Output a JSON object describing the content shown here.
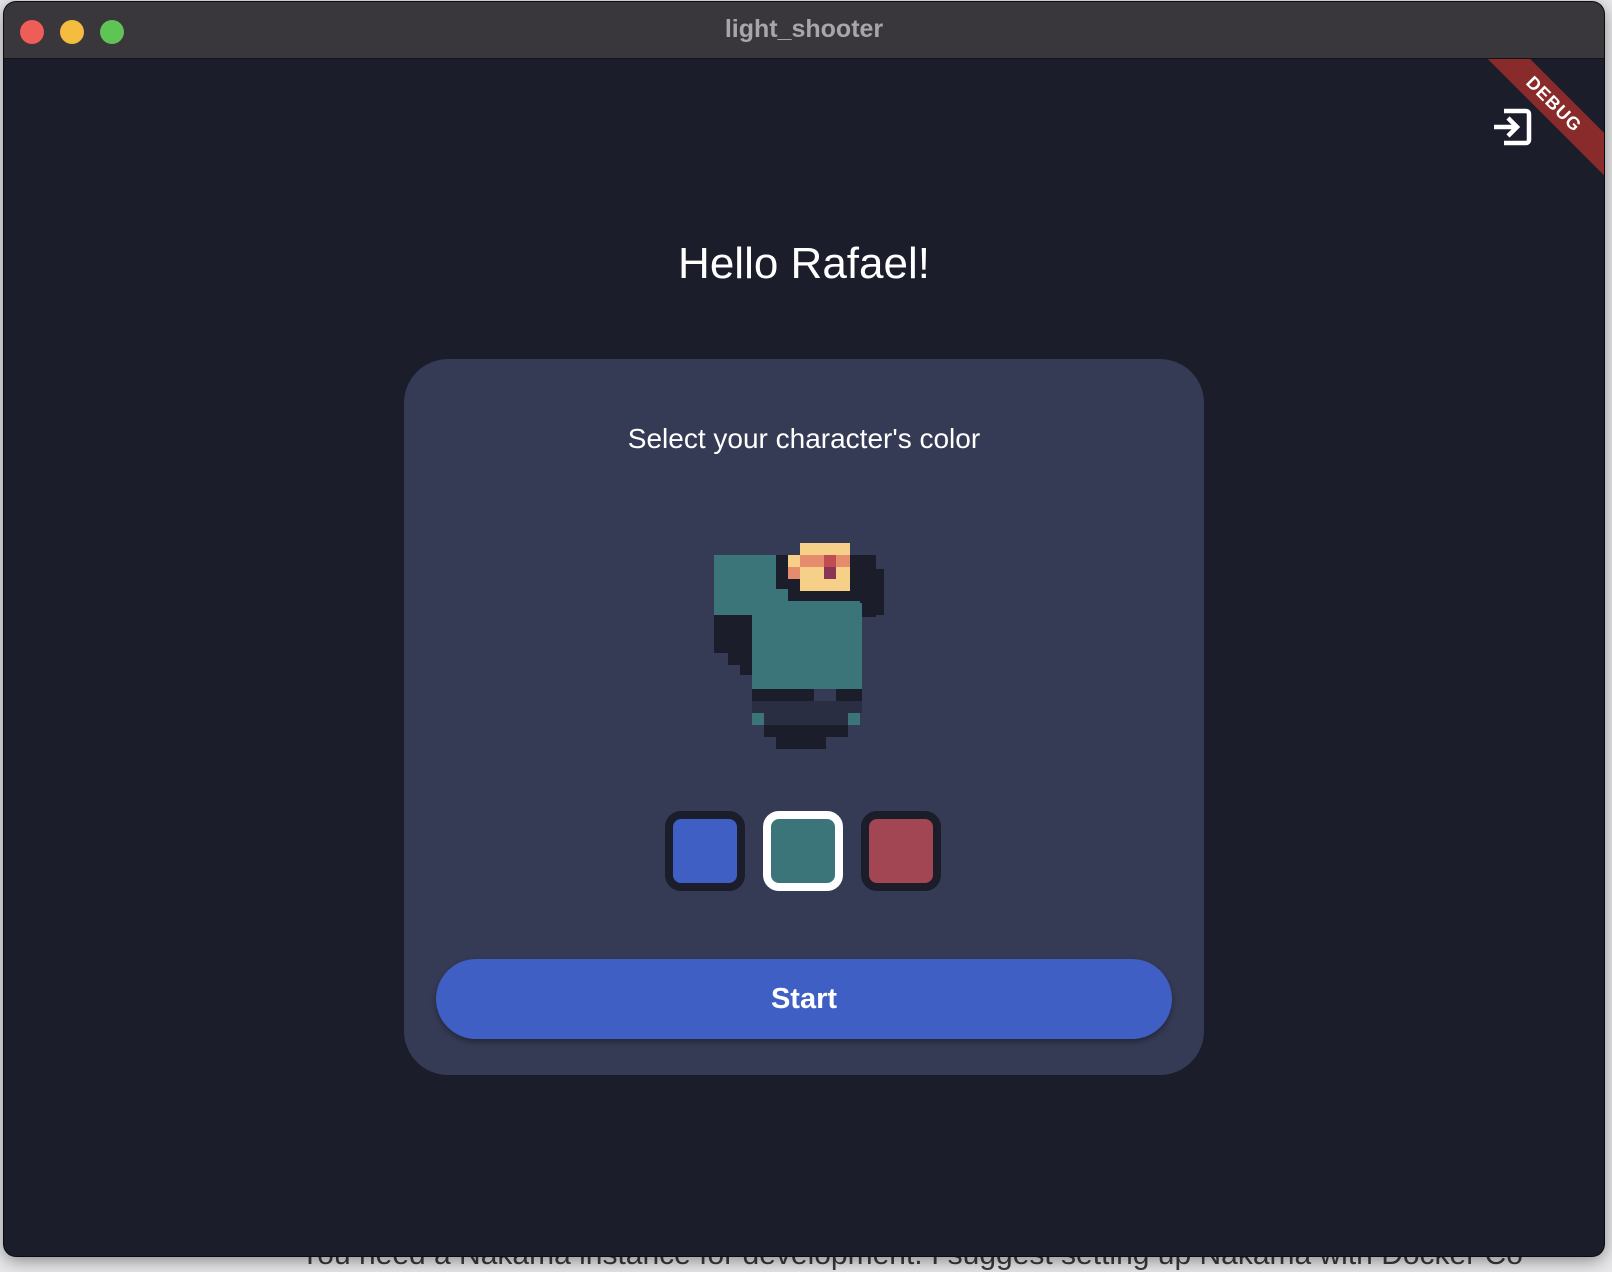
{
  "window": {
    "title": "light_shooter",
    "debug_label": "DEBUG"
  },
  "background": {
    "partial_text": "You need a Nakama instance for development. I suggest setting up Nakama with Docker Co"
  },
  "header": {
    "exit_icon": "login-icon"
  },
  "main": {
    "greeting": "Hello Rafael!",
    "card": {
      "title": "Select your character's color",
      "swatches": [
        {
          "color": "#3f5fc4",
          "selected": false
        },
        {
          "color": "#3b7479",
          "selected": true
        },
        {
          "color": "#a34653",
          "selected": false
        }
      ],
      "start_label": "Start"
    }
  },
  "colors": {
    "window_bg": "#1b1d2b",
    "card_bg": "#353b55",
    "accent": "#3f5fc4",
    "character": "#3b7479"
  }
}
